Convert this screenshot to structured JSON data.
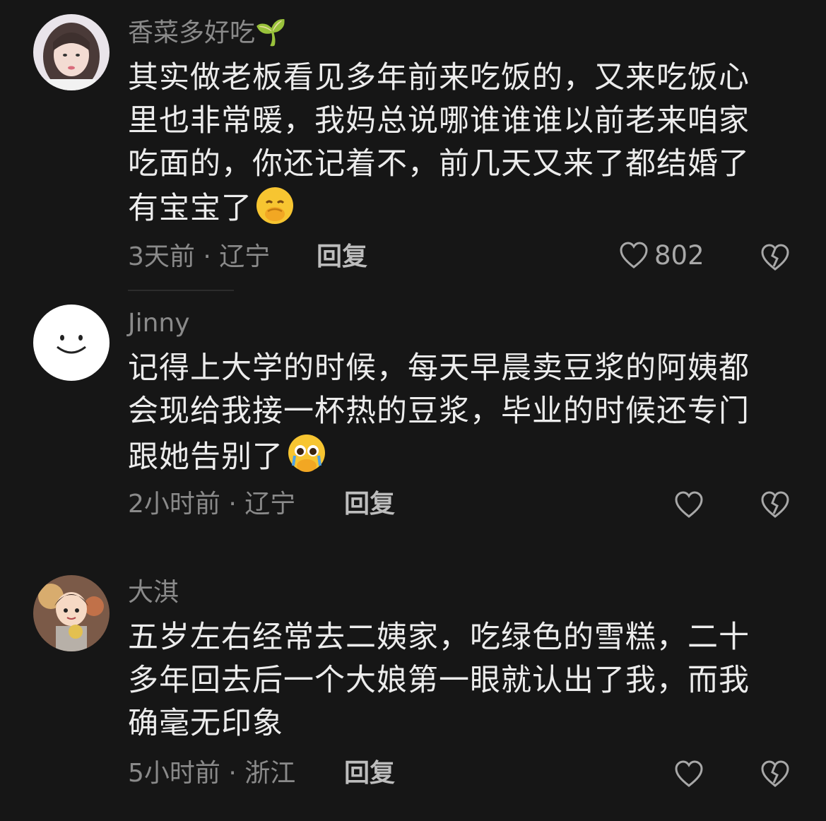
{
  "comments": [
    {
      "username": "香菜多好吃🌱",
      "body": "其实做老板看见多年前来吃饭的，又来吃饭心里也非常暖，我妈总说哪谁谁谁以前老来咱家吃面的，你还记着不，前几天又来了都结婚了有宝宝了",
      "emoji": "shy-face-emoji",
      "time_location": "3天前 · 辽宁",
      "reply_label": "回复",
      "likes": "802"
    },
    {
      "username": "Jinny",
      "body": "记得上大学的时候，每天早晨卖豆浆的阿姨都会现给我接一杯热的豆浆，毕业的时候还专门跟她告别了",
      "emoji": "teary-face-emoji",
      "time_location": "2小时前 · 辽宁",
      "reply_label": "回复",
      "likes": ""
    },
    {
      "username": "大淇",
      "body": "五岁左右经常去二姨家，吃绿色的雪糕，二十多年回去后一个大娘第一眼就认出了我，而我确毫无印象",
      "emoji": "",
      "time_location": "5小时前 · 浙江",
      "reply_label": "回复",
      "likes": ""
    }
  ],
  "icons": {
    "like": "heart-outline-icon",
    "dislike": "broken-heart-icon"
  }
}
